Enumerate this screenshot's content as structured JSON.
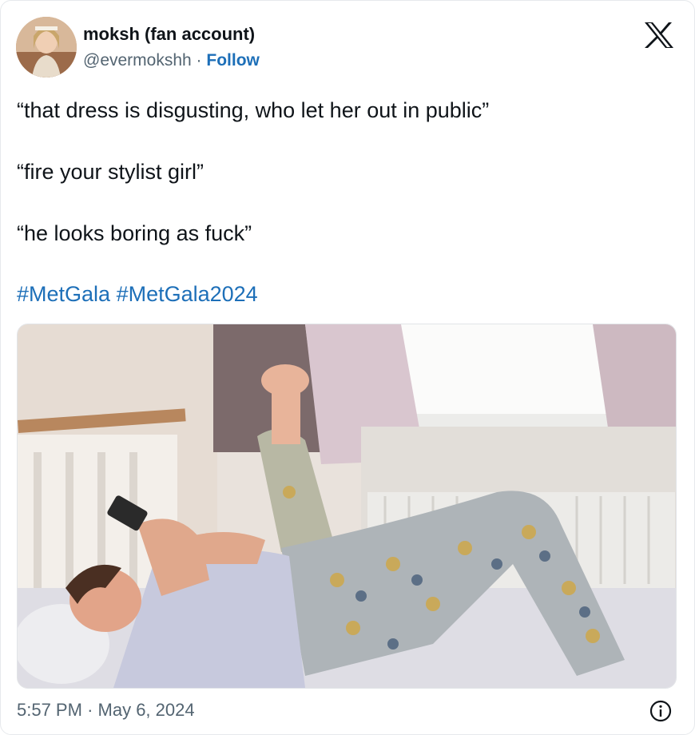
{
  "author": {
    "display_name": "moksh (fan account)",
    "handle": "@evermokshh",
    "separator": "·",
    "follow_label": "Follow"
  },
  "tweet": {
    "lines": [
      "“that dress is disgusting, who let her out in public”",
      "“fire your stylist girl”",
      "“he looks boring as fuck”"
    ],
    "hashtags": [
      "#MetGala",
      "#MetGala2024"
    ]
  },
  "meta": {
    "time": "5:57 PM",
    "separator": "·",
    "date": "May 6, 2024"
  },
  "icons": {
    "platform": "x-logo-icon",
    "info": "info-icon"
  },
  "colors": {
    "link": "#1d6fb8",
    "secondary_text": "#536471",
    "primary_text": "#0f1419"
  }
}
